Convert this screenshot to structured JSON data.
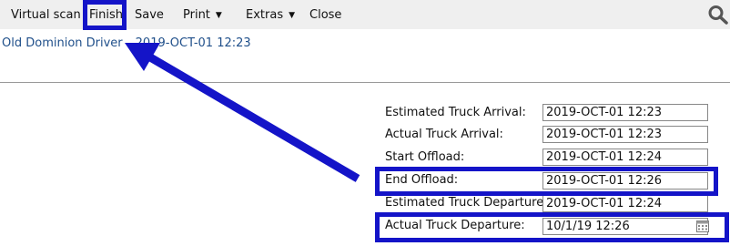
{
  "menu": {
    "virtual_scan": "Virtual scan",
    "finish": "Finish",
    "save": "Save",
    "print": "Print",
    "extras": "Extras",
    "close": "Close"
  },
  "header": {
    "driver": "Old Dominion Driver",
    "datetime": "2019-OCT-01 12:23"
  },
  "form": {
    "estimated_arrival": {
      "label": "Estimated Truck Arrival:",
      "value": "2019-OCT-01 12:23"
    },
    "actual_arrival": {
      "label": "Actual Truck Arrival:",
      "value": "2019-OCT-01 12:23"
    },
    "start_offload": {
      "label": "Start Offload:",
      "value": "2019-OCT-01 12:24"
    },
    "end_offload": {
      "label": "End Offload:",
      "value": "2019-OCT-01 12:26"
    },
    "estimated_departure": {
      "label": "Estimated Truck Departure:",
      "value": "2019-OCT-01 12:24"
    },
    "actual_departure": {
      "label": "Actual Truck Departure:",
      "value": "10/1/19 12:26"
    }
  },
  "colors": {
    "annotation": "#1414c8",
    "link": "#1f4f8a",
    "menubar": "#efefef"
  }
}
